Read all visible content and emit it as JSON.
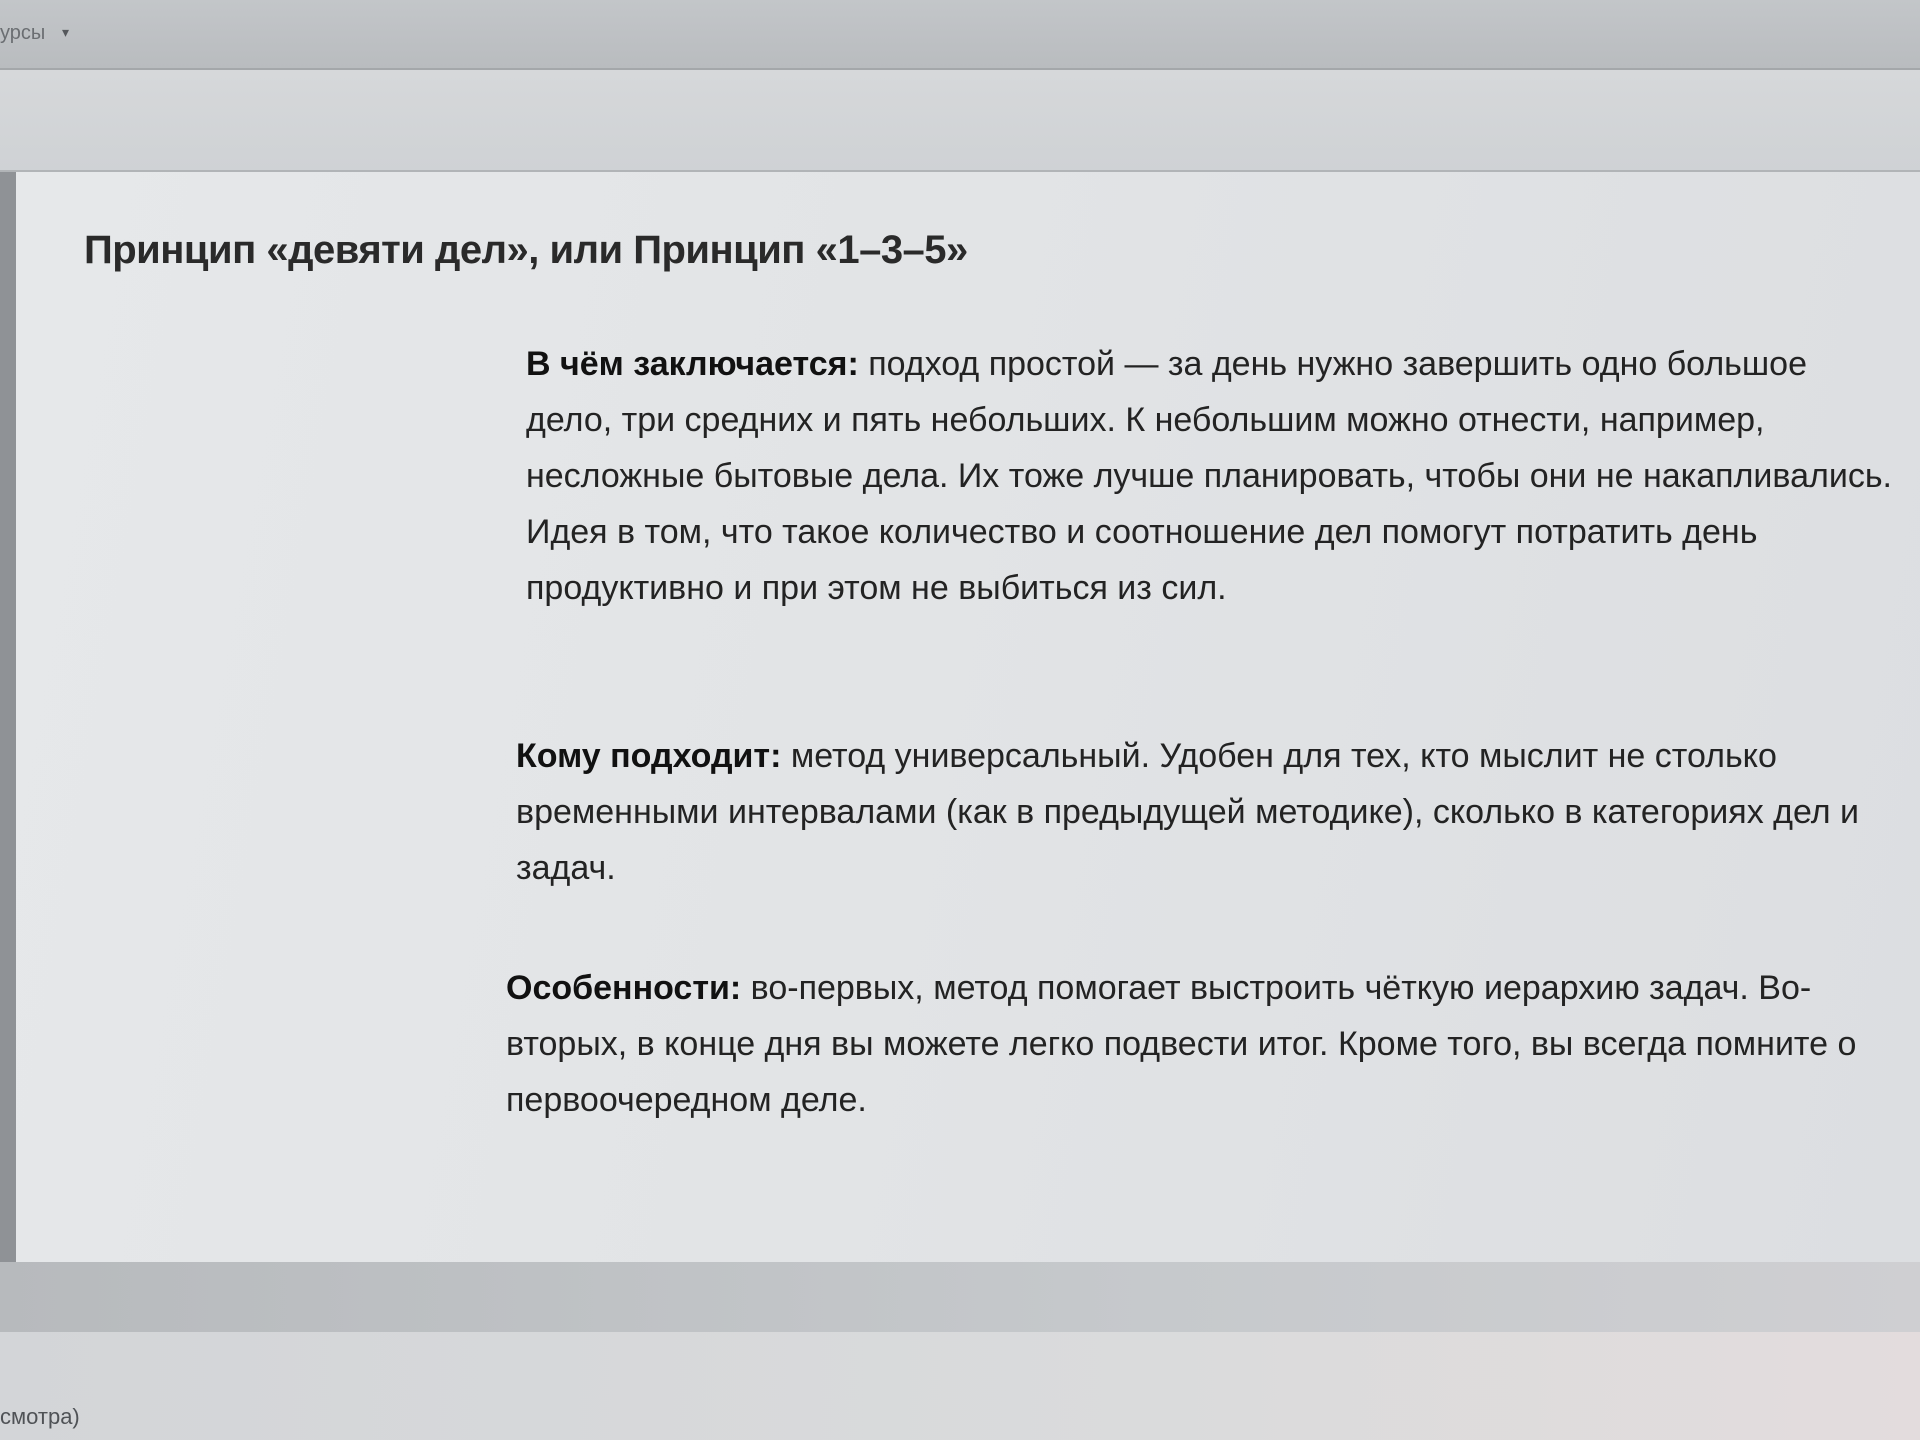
{
  "browser": {
    "tab_label": "урсы",
    "tab_caret": "▾"
  },
  "article": {
    "title": "Принцип «девяти дел», или Принцип «1–3–5»",
    "sections": [
      {
        "label": "В чём заключается:",
        "text": " подход простой — за день нужно завершить одно большое дело, три средних и пять небольших. К небольшим можно отнести, например, несложные бытовые дела. Их тоже лучше планировать, чтобы они не накапливались. Идея в том, что такое количество и соотношение дел помогут потратить день продуктивно и при этом не выбиться из сил."
      },
      {
        "label": "Кому подходит:",
        "text": " метод универсальный. Удобен для тех, кто мыслит не столько временными интервалами (как в предыдущей методике), сколько в категориях дел и задач."
      },
      {
        "label": "Особенности:",
        "text": " во-первых, метод помогает выстроить чёткую иерархию задач. Во-вторых, в конце дня вы можете легко подвести итог. Кроме того, вы всегда помните о первоочередном деле."
      }
    ]
  },
  "status_bar": {
    "text": "смотра)"
  }
}
